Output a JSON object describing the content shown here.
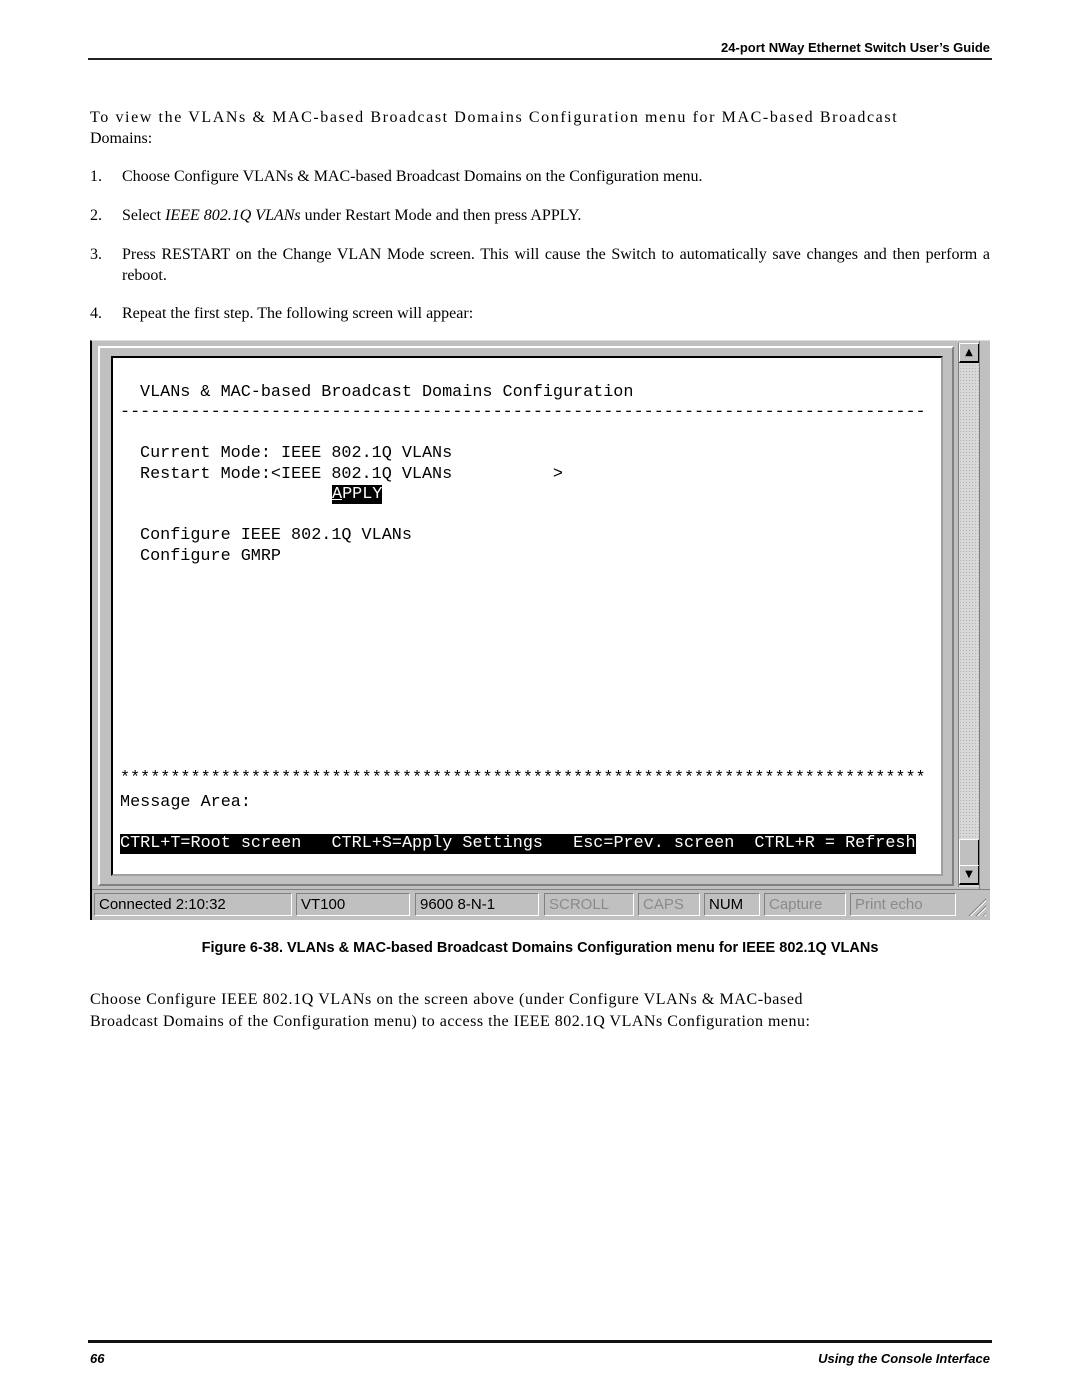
{
  "header": {
    "title": "24-port NWay Ethernet Switch User’s Guide"
  },
  "intro": {
    "line1": "To view the VLANs & MAC-based Broadcast Domains Configuration menu for MAC-based Broadcast",
    "line2": "Domains:"
  },
  "steps": [
    {
      "num": "1.",
      "text": "Choose Configure VLANs & MAC-based Broadcast Domains on the Configuration menu."
    },
    {
      "num": "2.",
      "text_pre": "Select ",
      "text_em": "IEEE 802.1Q VLANs",
      "text_post": " under Restart Mode and then press APPLY."
    },
    {
      "num": "3.",
      "text": "Press RESTART on the Change VLAN Mode screen. This will cause the Switch to automatically save changes and then perform a reboot."
    },
    {
      "num": "4.",
      "text": "Repeat the first step. The following screen will appear:"
    }
  ],
  "terminal": {
    "title": "VLANs & MAC-based Broadcast Domains Configuration",
    "separator": "--------------------------------------------------------------------------------",
    "current_mode_label": "Current Mode: ",
    "current_mode_value": "IEEE 802.1Q VLANs",
    "restart_mode_label": "Restart Mode:",
    "restart_mode_value": "<IEEE 802.1Q VLANs          >",
    "apply_first": "A",
    "apply_rest": "PPLY",
    "menu_items": [
      "Configure IEEE 802.1Q VLANs",
      "Configure GMRP"
    ],
    "stars": "********************************************************************************",
    "message_area_label": "Message Area:",
    "hotkeys": "CTRL+T=Root screen   CTRL+S=Apply Settings   Esc=Prev. screen  CTRL+R = Refresh",
    "scroll_up_glyph": "▲",
    "scroll_down_glyph": "▼"
  },
  "statusbar": {
    "connected": "Connected 2:10:32",
    "emulation": "VT100",
    "port_settings": "9600 8-N-1",
    "scroll": "SCROLL",
    "caps": "CAPS",
    "num": "NUM",
    "capture": "Capture",
    "print_echo": "Print echo"
  },
  "caption": "Figure 6-38.  VLANs & MAC-based Broadcast Domains  Configuration menu for IEEE 802.1Q VLANs",
  "outro": {
    "line1": "Choose Configure IEEE 802.1Q VLANs on the screen above (under Configure VLANs & MAC-based",
    "line2": "Broadcast Domains of the Configuration menu) to access the IEEE 802.1Q VLANs Configuration menu:"
  },
  "footer": {
    "page_number": "66",
    "section": "Using the Console Interface"
  }
}
